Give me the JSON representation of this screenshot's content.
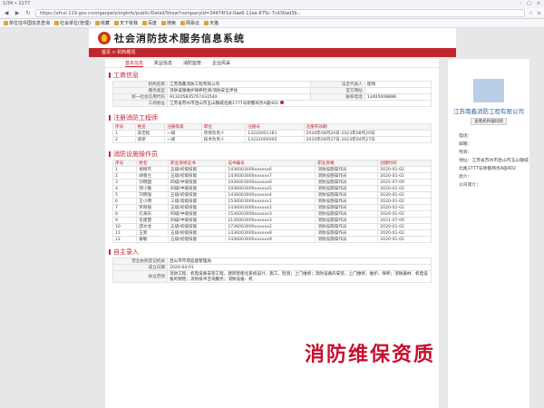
{
  "browser": {
    "title": "1/34 • 1177",
    "url": "https://xfcxl.119.gov.cn/organjwtz/orglnfo/public/Detail/Show?companyId=34474f1d-0ae6-11ea-875c-7cd30ad3b...",
    "bookmarks": [
      "单位住中国信息查询",
      "社会单位(管理)",
      "收藏",
      "天下有我",
      "百度",
      "搜索",
      "网易云",
      "天猫"
    ]
  },
  "site": {
    "title": "社会消防技术服务信息系统",
    "breadcrumb": "首页 > 机构概况"
  },
  "tabs": [
    "基本信息",
    "执业信息",
    "消防监管",
    "企业风采"
  ],
  "business_info": {
    "section": "工商信息",
    "rows": [
      [
        "机构名称",
        "江苏南鑫消防工程有限公司",
        "法定代表人",
        "崔晴"
      ],
      [
        "服务类型",
        "消防设施维护保养检测/消防安全评估",
        "官方网站",
        ""
      ],
      [
        "统一社会信用代码",
        "91320583576743354X",
        "联系电话",
        "13405008888"
      ],
      [
        "工商地址",
        "江苏省苏州市昆山市玉山镇城北路1777号新都商务A座402",
        "",
        ""
      ]
    ]
  },
  "engineers": {
    "section": "注册消防工程师",
    "headers": [
      "序号",
      "姓名",
      "注册等级",
      "职位",
      "注册号",
      "注册有效期"
    ],
    "rows": [
      [
        "1",
        "宋忠松",
        "一级",
        "项目负责人",
        "13220001181",
        "2020年08月20日-2023年08月20日"
      ],
      [
        "2",
        "武新",
        "一级",
        "技术负责人",
        "13222000095",
        "2020年04月27日-2023年04月27日"
      ]
    ]
  },
  "operators": {
    "section": "消防设施操作员",
    "headers": [
      "序号",
      "姓名",
      "职业资格证书",
      "证书编号",
      "职业资格",
      "创建时间"
    ],
    "rows": [
      [
        "1",
        "谢德杰",
        "五级/初级技能",
        "1436003000xxxxxx6",
        "消防设施操作员",
        "2020-01-02"
      ],
      [
        "2",
        "胡春兰",
        "五级/初级技能",
        "1436003000xxxxxx7",
        "消防设施操作员",
        "2020-01-02"
      ],
      [
        "3",
        "刘明国",
        "四级/中级技能",
        "1936003000xxxxxx0",
        "消防设施操作员",
        "2021-07-09"
      ],
      [
        "4",
        "郭小敬",
        "四级/中级技能",
        "1936003000xxxxxx5",
        "消防设施操作员",
        "2020-01-02"
      ],
      [
        "5",
        "刘明强",
        "五级/初级技能",
        "1436003000xxxxxx4",
        "消防设施操作员",
        "2020-01-02"
      ],
      [
        "6",
        "王小明",
        "三级/高级技能",
        "1536003000xxxxxx1",
        "消防设施操作员",
        "2020-01-02"
      ],
      [
        "7",
        "罗刚丽",
        "五级/初级技能",
        "1436003000xxxxxx2",
        "消防设施操作员",
        "2020-01-02"
      ],
      [
        "8",
        "孔来乐",
        "四级/中级技能",
        "1536003000xxxxxx3",
        "消防设施操作员",
        "2020-01-02"
      ],
      [
        "9",
        "毛建慧",
        "四级/中级技能",
        "2136003000xxxxxx3",
        "消防设施操作员",
        "2021-07-09"
      ],
      [
        "10",
        "邵文龙",
        "五级/初级技能",
        "1736003000xxxxxx2",
        "消防设施操作员",
        "2020-01-02"
      ],
      [
        "11",
        "王新",
        "五级/初级技能",
        "1436003000xxxxxx8",
        "消防设施操作员",
        "2020-01-02"
      ],
      [
        "12",
        "秦敏",
        "五级/初级技能",
        "1436003000xxxxxx9",
        "消防设施操作员",
        "2020-01-02"
      ]
    ]
  },
  "self_report": {
    "section": "自主录入",
    "rows": [
      [
        "营业执照登记机关",
        "昆山市市场监督管理局"
      ],
      [
        "成立日期",
        "2020-04-01"
      ],
      [
        "执业范围",
        "消防工程、机电设备安装工程，建筑智能化系统设计、施工，检测；上门维修；消防设备的安装，上门维修，维护，保养；消防器材、机电设备的销售；消防技术咨询服务；消防设备、机"
      ]
    ]
  },
  "side": {
    "company": "江苏南鑫消防工程有限公司",
    "button": "查看机构编码图",
    "meta": [
      "电话：",
      "邮箱：",
      "传真：",
      "地址：江苏省苏州市昆山市玉山镇城北路1777号新都商务A座402",
      "简介：",
      "公司简介："
    ]
  },
  "watermark": "消防维保资质",
  "colors": {
    "accent": "#c0272d",
    "link": "#2a5fa0"
  }
}
